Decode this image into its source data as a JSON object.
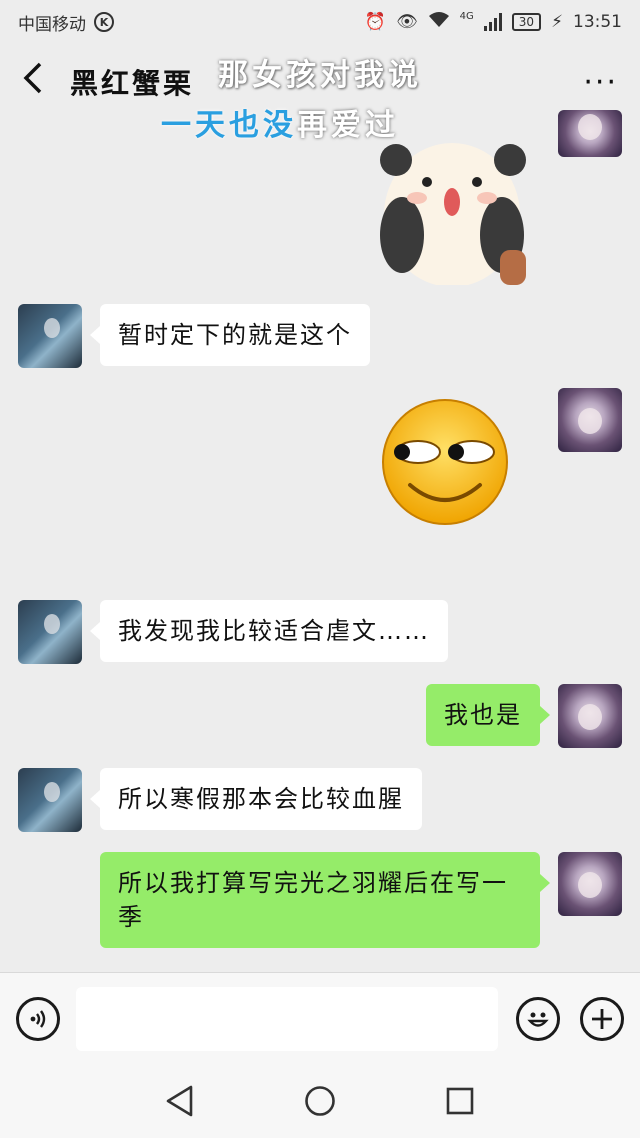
{
  "status": {
    "carrier": "中国移动",
    "badge": "K",
    "network": "4G",
    "battery": "30",
    "time": "13:51"
  },
  "header": {
    "title": "黑红蟹栗",
    "more": "···"
  },
  "overlay": {
    "line1": "那女孩对我说",
    "line2_blue": "一天也没",
    "line2_white": "再爱过"
  },
  "messages": [
    {
      "from": "other",
      "text": "暂时定下的就是这个"
    },
    {
      "from": "other",
      "text": "我发现我比较适合虐文……"
    },
    {
      "from": "self",
      "text": "我也是"
    },
    {
      "from": "other",
      "text": "所以寒假那本会比较血腥"
    },
    {
      "from": "self",
      "text": "所以我打算写完光之羽耀后在写一季"
    }
  ],
  "inputbar": {
    "placeholder": ""
  },
  "colors": {
    "background": "#ededed",
    "bubble_out": "#95ec69",
    "bubble_in": "#ffffff",
    "overlay_blue": "#2a9fe0"
  },
  "icons": [
    "back-icon",
    "more-icon",
    "voice-icon",
    "emoji-icon",
    "plus-icon",
    "nav-back-icon",
    "nav-home-icon",
    "nav-recents-icon"
  ]
}
